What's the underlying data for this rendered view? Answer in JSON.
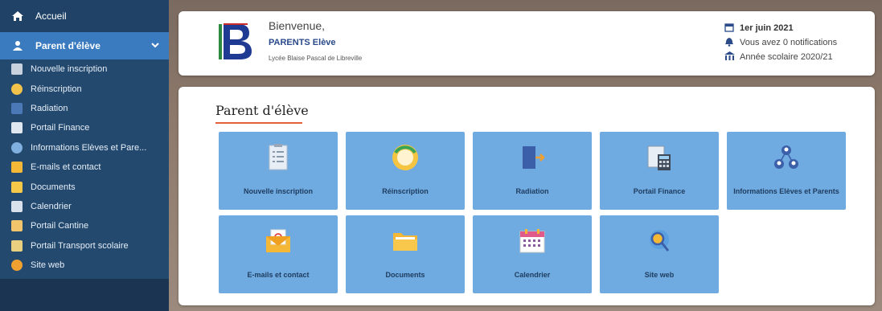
{
  "sidebar": {
    "accueil": "Accueil",
    "section": "Parent d'élève",
    "items": [
      {
        "label": "Nouvelle inscription",
        "color": "#c8d2de"
      },
      {
        "label": "Réinscription",
        "color": "#f3c24a"
      },
      {
        "label": "Radiation",
        "color": "#4b79b8"
      },
      {
        "label": "Portail Finance",
        "color": "#dfe7f0"
      },
      {
        "label": "Informations Elèves et Pare...",
        "color": "#7fb0e0"
      },
      {
        "label": "E-mails et contact",
        "color": "#f5b736"
      },
      {
        "label": "Documents",
        "color": "#f5c84a"
      },
      {
        "label": "Calendrier",
        "color": "#d9e2ec"
      },
      {
        "label": "Portail Cantine",
        "color": "#f0c56b"
      },
      {
        "label": "Portail Transport scolaire",
        "color": "#e8d080"
      },
      {
        "label": "Site web",
        "color": "#f0a030"
      }
    ]
  },
  "header": {
    "welcome": "Bienvenue,",
    "user": "PARENTS Elève",
    "school": "Lycée Blaise Pascal de Libreville",
    "date": "1er juin 2021",
    "notifications": "Vous avez 0 notifications",
    "school_year": "Année scolaire 2020/21"
  },
  "main": {
    "title": "Parent d'élève",
    "tiles": [
      {
        "label": "Nouvelle inscription",
        "icon": "checklist-icon"
      },
      {
        "label": "Réinscription",
        "icon": "refresh-circle-icon"
      },
      {
        "label": "Radiation",
        "icon": "exit-door-icon"
      },
      {
        "label": "Portail Finance",
        "icon": "finance-calculator-icon"
      },
      {
        "label": "Informations Elèves et Parents",
        "icon": "people-network-icon"
      },
      {
        "label": "E-mails et contact",
        "icon": "email-envelope-icon"
      },
      {
        "label": "Documents",
        "icon": "folder-icon"
      },
      {
        "label": "Calendrier",
        "icon": "calendar-icon"
      },
      {
        "label": "Site web",
        "icon": "web-search-icon"
      }
    ]
  },
  "colors": {
    "sidebar_bg": "#23496f",
    "sidebar_active": "#3a7bc0",
    "tile_bg": "#6faae0",
    "title_underline": "#e4603a"
  }
}
